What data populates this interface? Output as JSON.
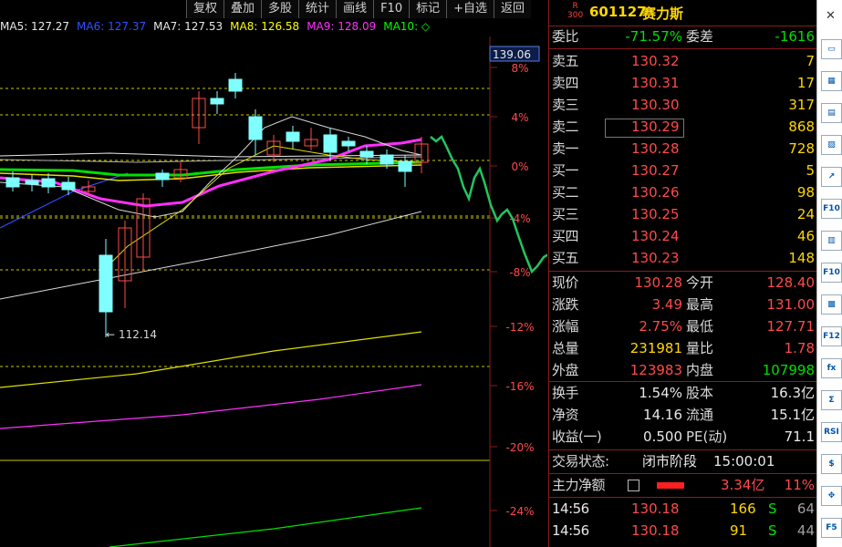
{
  "toolbar": [
    "复权",
    "叠加",
    "多股",
    "统计",
    "画线",
    "F10",
    "标记",
    "+自选",
    "返回"
  ],
  "ma_legend": [
    {
      "label": "MA5: 127.27",
      "color": "#e8e8e8"
    },
    {
      "label": "MA6: 127.37",
      "color": "#3050ff"
    },
    {
      "label": "MA7: 127.53",
      "color": "#e8e8e8"
    },
    {
      "label": "MA8: 126.58",
      "color": "#ffff00"
    },
    {
      "label": "MA9: 128.09",
      "color": "#ff30ff"
    },
    {
      "label": "MA10: ◇",
      "color": "#00ff00"
    }
  ],
  "price_tag": "139.06",
  "low_label": "112.14",
  "y_axis_ticks": [
    "8%",
    "4%",
    "0%",
    "-4%",
    "-8%",
    "-12%",
    "-16%",
    "-20%",
    "-24%"
  ],
  "stock": {
    "badge_top": "R",
    "badge_bottom": "300",
    "code": "601127",
    "name": "赛力斯"
  },
  "committee": {
    "ratio_label": "委比",
    "ratio": "-71.57%",
    "diff_label": "委差",
    "diff": "-1616"
  },
  "asks": [
    {
      "label": "卖五",
      "price": "130.32",
      "vol": "7"
    },
    {
      "label": "卖四",
      "price": "130.31",
      "vol": "17"
    },
    {
      "label": "卖三",
      "price": "130.30",
      "vol": "317"
    },
    {
      "label": "卖二",
      "price": "130.29",
      "vol": "868"
    },
    {
      "label": "卖一",
      "price": "130.28",
      "vol": "728"
    }
  ],
  "bids": [
    {
      "label": "买一",
      "price": "130.27",
      "vol": "5"
    },
    {
      "label": "买二",
      "price": "130.26",
      "vol": "98"
    },
    {
      "label": "买三",
      "price": "130.25",
      "vol": "24"
    },
    {
      "label": "买四",
      "price": "130.24",
      "vol": "46"
    },
    {
      "label": "买五",
      "price": "130.23",
      "vol": "148"
    }
  ],
  "quote": [
    {
      "l1": "现价",
      "v1": "130.28",
      "c1": "red",
      "l2": "今开",
      "v2": "128.40",
      "c2": "red"
    },
    {
      "l1": "涨跌",
      "v1": "3.49",
      "c1": "red",
      "l2": "最高",
      "v2": "131.00",
      "c2": "red"
    },
    {
      "l1": "涨幅",
      "v1": "2.75%",
      "c1": "red",
      "l2": "最低",
      "v2": "127.71",
      "c2": "red"
    },
    {
      "l1": "总量",
      "v1": "231981",
      "c1": "yellow",
      "l2": "量比",
      "v2": "1.78",
      "c2": "red"
    },
    {
      "l1": "外盘",
      "v1": "123983",
      "c1": "red",
      "l2": "内盘",
      "v2": "107998",
      "c2": "green"
    }
  ],
  "stats": [
    {
      "l1": "换手",
      "v1": "1.54%",
      "l2": "股本",
      "v2": "16.3亿"
    },
    {
      "l1": "净资",
      "v1": "14.16",
      "l2": "流通",
      "v2": "15.1亿"
    },
    {
      "l1": "收益(一)",
      "v1": "0.500",
      "l2": "PE(动)",
      "v2": "71.1"
    }
  ],
  "trade_status": {
    "label": "交易状态:",
    "value": "闭市阶段",
    "time": "15:00:01"
  },
  "main_flow": {
    "label": "主力净额",
    "amount": "3.34亿",
    "pct": "11%"
  },
  "ticks": [
    {
      "time": "14:56",
      "price": "130.18",
      "vol": "166",
      "side": "S",
      "num": "64"
    },
    {
      "time": "14:56",
      "price": "130.18",
      "vol": "91",
      "side": "S",
      "num": "44"
    }
  ],
  "side_icons": [
    "close-x",
    "market",
    "grid",
    "stats",
    "chart",
    "trend",
    "f10",
    "table",
    "f10b",
    "indicator",
    "f12",
    "fx",
    "sum",
    "rsi",
    "dollar",
    "move",
    "f5"
  ],
  "side_icon_text": [
    "✕",
    "▭",
    "▦",
    "▤",
    "▨",
    "↗",
    "F10",
    "▥",
    "F10",
    "▩",
    "F12",
    "fx",
    "Σ",
    "RSI",
    "$",
    "✥",
    "F5"
  ]
}
